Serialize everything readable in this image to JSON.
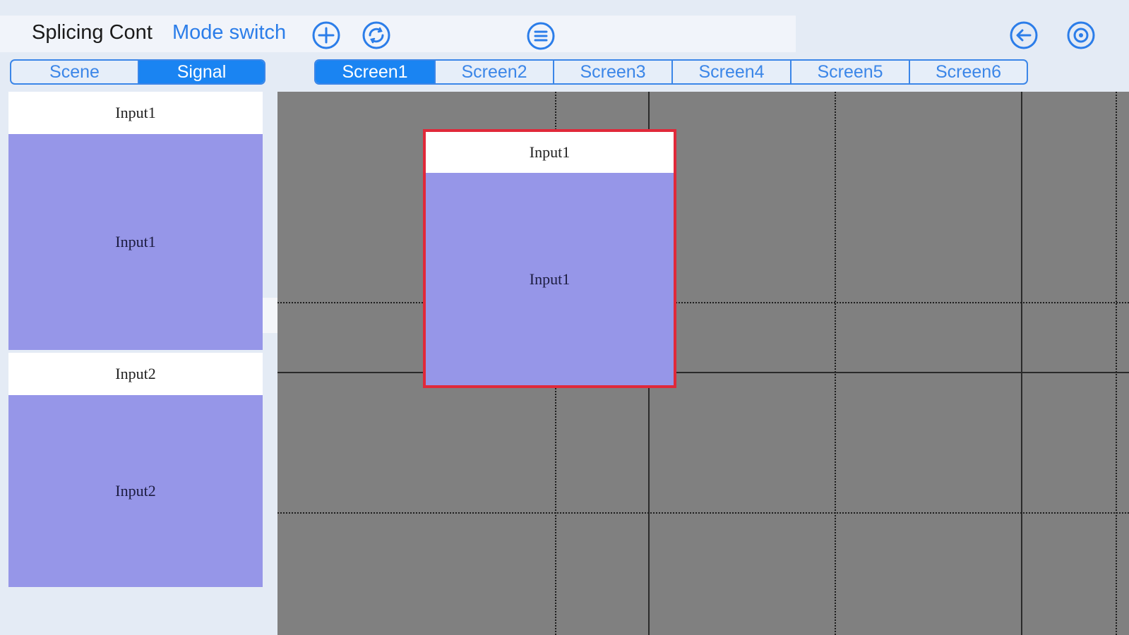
{
  "header": {
    "title": "Splicing Cont",
    "mode_switch": "Mode switch",
    "icons": [
      "add-icon",
      "refresh-icon",
      "menu-icon",
      "back-icon",
      "settings-icon"
    ]
  },
  "left_tabs": [
    {
      "label": "Scene",
      "active": false
    },
    {
      "label": "Signal",
      "active": true
    }
  ],
  "screen_tabs": [
    {
      "label": "Screen1",
      "active": true
    },
    {
      "label": "Screen2",
      "active": false
    },
    {
      "label": "Screen3",
      "active": false
    },
    {
      "label": "Screen4",
      "active": false
    },
    {
      "label": "Screen5",
      "active": false
    },
    {
      "label": "Screen6",
      "active": false
    }
  ],
  "signals": [
    {
      "title": "Input1",
      "body": "Input1"
    },
    {
      "title": "Input2",
      "body": "Input2"
    }
  ],
  "canvas_window": {
    "title": "Input1",
    "body": "Input1"
  },
  "colors": {
    "accent": "#1a84f2",
    "signal_fill": "#9696e8",
    "canvas_bg": "#808080",
    "selected_border": "#e0293a"
  }
}
